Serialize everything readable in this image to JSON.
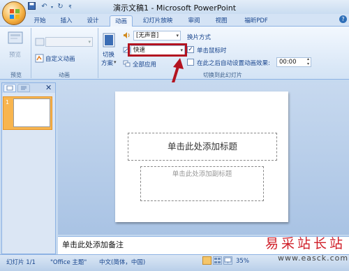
{
  "window": {
    "title": "演示文稿1 - Microsoft PowerPoint"
  },
  "tabs": [
    "开始",
    "插入",
    "设计",
    "动画",
    "幻灯片放映",
    "审阅",
    "视图",
    "福昕PDF"
  ],
  "active_tab": "动画",
  "ribbon": {
    "preview": {
      "button": "预览",
      "group": "预览"
    },
    "animation": {
      "custom": "自定义动画",
      "group": "动画"
    },
    "transition": {
      "switch_scheme_line1": "切换",
      "switch_scheme_line2": "方案",
      "sound_value": "[无声音]",
      "speed_value": "快速",
      "apply_all": "全部应用",
      "group": "切换到此幻灯片"
    },
    "advance": {
      "title": "换片方式",
      "on_click": "单击鼠标时",
      "on_click_checked": true,
      "after_time": "在此之后自动设置动画效果:",
      "after_time_checked": false,
      "time_value": "00:00"
    }
  },
  "slide": {
    "title_placeholder": "单击此处添加标题",
    "subtitle_placeholder": "单击此处添加副标题",
    "thumbnail_number": "1"
  },
  "notes_placeholder": "单击此处添加备注",
  "status": {
    "slide_count": "幻灯片 1/1",
    "theme": "\"Office 主题\"",
    "language": "中文(简体，中国)",
    "zoom": "35%"
  },
  "watermark": {
    "text": "易采站长站",
    "url": "www.easck.com"
  },
  "colors": {
    "highlight": "#b31320",
    "active_tab": "#eef4fc",
    "office_button": "#f5b346"
  }
}
